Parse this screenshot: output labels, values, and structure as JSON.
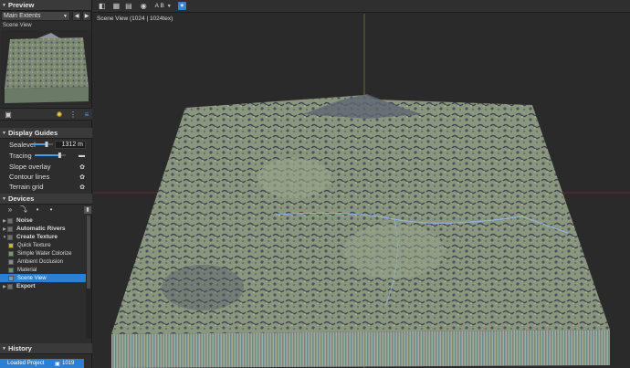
{
  "preview": {
    "header": "Preview",
    "extent_select": "Main Extents",
    "prev_glyph": "◀",
    "next_glyph": "▶",
    "scene_label": "Scene View"
  },
  "display_guides": {
    "header": "Display Guides",
    "sealevel_label": "Sealevel",
    "sealevel_value": "1312 m",
    "sealevel_fraction": 0.75,
    "tracing_label": "Tracing",
    "tracing_fraction": 0.85,
    "slope_overlay": "Slope overlay",
    "contour_lines": "Contour lines",
    "terrain_grid": "Terrain grid"
  },
  "devices": {
    "header": "Devices",
    "toolbar_glyphs": [
      "»",
      "⤵",
      "•",
      "•"
    ],
    "items": [
      {
        "label": "Noise",
        "group": true,
        "color": "#6f6f6f"
      },
      {
        "label": "Automatic Rivers",
        "group": true,
        "color": "#6f6f6f"
      },
      {
        "label": "Create Texture",
        "group": true,
        "color": "#6f6f6f"
      },
      {
        "label": "Quick Texture",
        "group": false,
        "color": "#c9b24a"
      },
      {
        "label": "Simple Water Colorize",
        "group": false,
        "color": "#7a9a6e"
      },
      {
        "label": "Ambient Occlusion",
        "group": false,
        "color": "#8a8a8a"
      },
      {
        "label": "Material",
        "group": false,
        "color": "#6a9a5a"
      },
      {
        "label": "Scene View",
        "group": false,
        "color": "#5aa0d8",
        "selected": true
      },
      {
        "label": "Export",
        "group": true,
        "color": "#6f6f6f"
      }
    ]
  },
  "history": {
    "header": "History",
    "item_label": "Loaded Project",
    "item_value": "1019"
  },
  "viewport": {
    "title": "Scene View (1024 | 1024tex)",
    "ab_label": "A B"
  },
  "icons": {
    "preview_toolbar": "camera-icon",
    "lightbulb": "lightbulb-icon",
    "list": "list-icon",
    "settings": "gear-icon"
  }
}
